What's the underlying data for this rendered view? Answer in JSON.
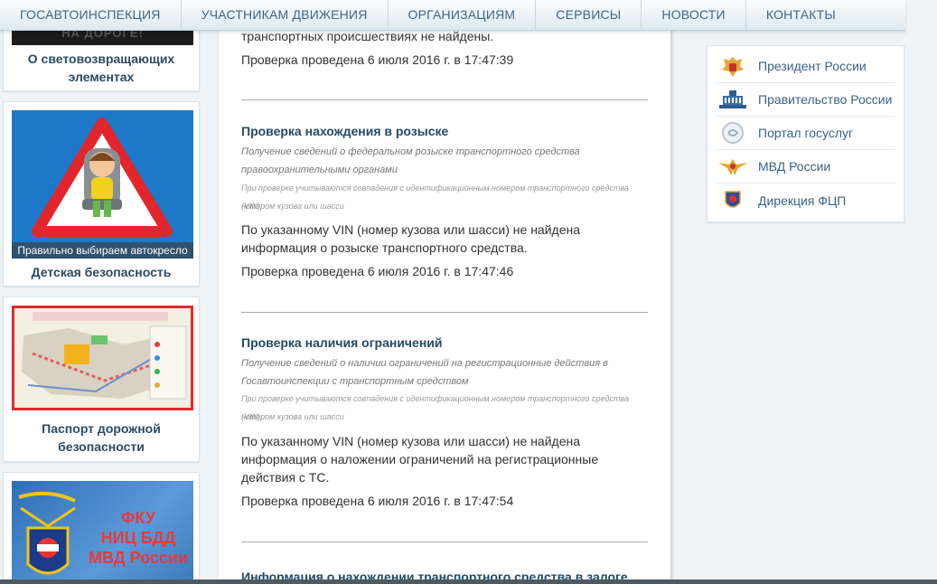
{
  "nav": {
    "items": [
      "ГОСАВТОИНСПЕКЦИЯ",
      "УЧАСТНИКАМ ДВИЖЕНИЯ",
      "ОРГАНИЗАЦИЯМ",
      "СЕРВИСЫ",
      "НОВОСТИ",
      "КОНТАКТЫ"
    ]
  },
  "left": {
    "cards": [
      {
        "title_line1": "О световозвращающих",
        "title_line2": "элементах",
        "img_text": "НА ДОРОГЕ!"
      },
      {
        "title_line1": "Детская безопасность",
        "img_caption": "Правильно выбираем автокресло"
      },
      {
        "title_line1": "Паспорт дорожной",
        "title_line2": "безопасности"
      },
      {
        "img_line1": "ФКУ",
        "img_line2": "НИЦ БДД",
        "img_line3": "МВД России"
      }
    ]
  },
  "main": {
    "top": {
      "line1": "транспортных происшествиях не найдены.",
      "checked": "Проверка проведена 6 июля 2016 г. в 17:47:39"
    },
    "wanted": {
      "title": "Проверка нахождения в розыске",
      "desc_line1": "Получение сведений о федеральном розыске транспортного средства",
      "desc_line2": "правоохранительными органами",
      "note_line1": "При проверке учитываются совпадения с идентификационным номером транспортного средства (VIN),",
      "note_line2": "номером кузова или шасси",
      "result_line1": "По указанному VIN (номер кузова или шасси) не найдена",
      "result_line2": "информация о розыске транспортного средства.",
      "checked": "Проверка проведена 6 июля 2016 г. в 17:47:46"
    },
    "restrictions": {
      "title": "Проверка наличия ограничений",
      "desc_line1": "Получение сведений о наличии ограничений на регистрационные действия в",
      "desc_line2": "Госавтоинспекции с транспортным средством",
      "note_line1": "При проверке учитываются совпадения с идентификационным номером транспортного средства (VIN),",
      "note_line2": "номером кузова или шасси",
      "result_line1": "По указанному VIN (номер кузова или шасси) не найдена",
      "result_line2": "информация о наложении ограничений на регистрационные",
      "result_line3": "действия с ТС.",
      "checked": "Проверка проведена 6 июля 2016 г. в 17:47:54"
    },
    "pledge": {
      "title": "Информация о нахождении транспортного средства в залоге"
    }
  },
  "right": {
    "links": [
      {
        "label": "Президент России",
        "icon": "russian-eagle-icon"
      },
      {
        "label": "Правительство России",
        "icon": "government-building-icon"
      },
      {
        "label": "Портал госуслуг",
        "icon": "gosuslugi-icon"
      },
      {
        "label": "МВД России",
        "icon": "mvd-eagle-icon"
      },
      {
        "label": "Дирекция ФЦП",
        "icon": "fcp-emblem-icon"
      }
    ]
  },
  "colors": {
    "nav_text": "#3d6688",
    "link_text": "#3a6386",
    "heading": "#234a66",
    "card_title": "#2b4a63"
  }
}
